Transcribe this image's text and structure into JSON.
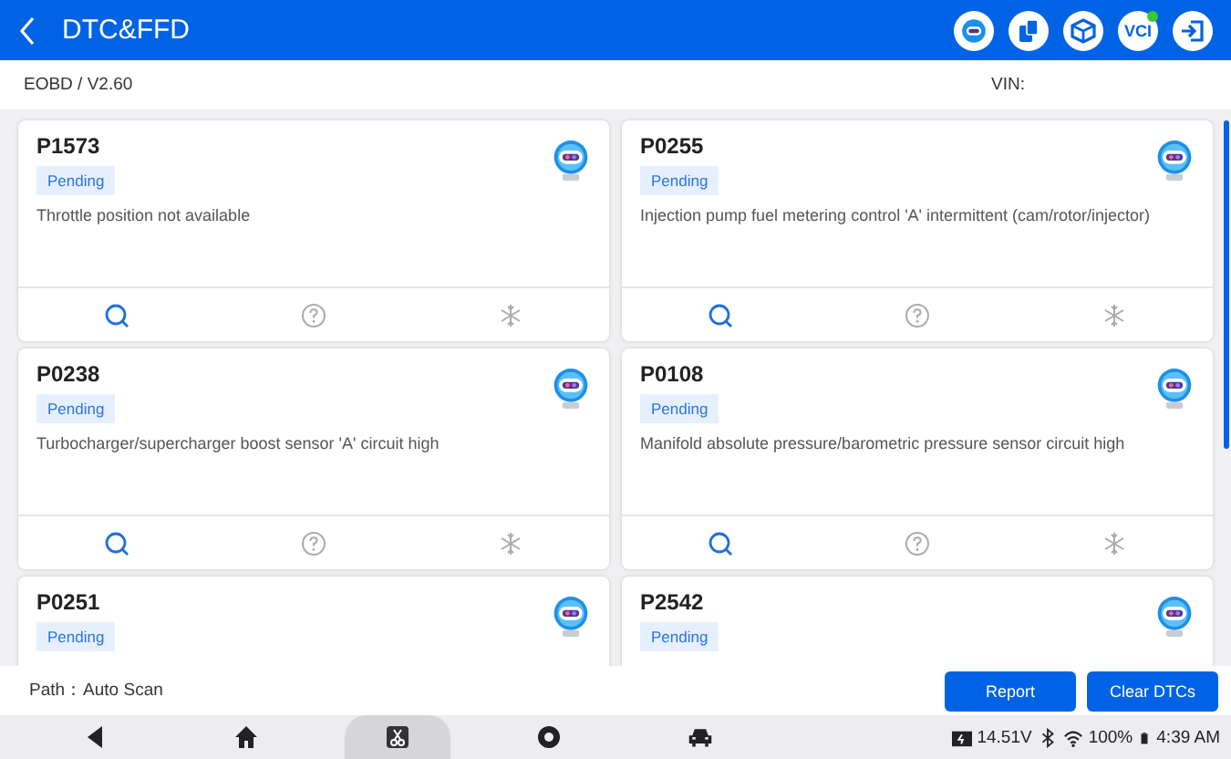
{
  "header": {
    "title": "DTC&FFD",
    "vci_label": "VCI"
  },
  "subheader": {
    "version": "EOBD / V2.60",
    "vin_label": "VIN:"
  },
  "dtcs": [
    {
      "code": "P1573",
      "status": "Pending",
      "description": "Throttle position not available"
    },
    {
      "code": "P0255",
      "status": "Pending",
      "description": "Injection pump fuel metering control 'A' intermittent (cam/rotor/injector)"
    },
    {
      "code": "P0238",
      "status": "Pending",
      "description": "Turbocharger/supercharger boost sensor 'A' circuit high"
    },
    {
      "code": "P0108",
      "status": "Pending",
      "description": "Manifold absolute pressure/barometric pressure sensor circuit high"
    },
    {
      "code": "P0251",
      "status": "Pending"
    },
    {
      "code": "P2542",
      "status": "Pending"
    }
  ],
  "footer": {
    "path_label": "Path：",
    "path": "Auto Scan",
    "buttons": [
      "Report",
      "Clear DTCs"
    ]
  },
  "nav": {
    "items": [
      {
        "kind": "back",
        "selected": false
      },
      {
        "kind": "home",
        "selected": false
      },
      {
        "kind": "diag",
        "selected": true
      },
      {
        "kind": "browser",
        "selected": false
      },
      {
        "kind": "car",
        "selected": false
      }
    ]
  },
  "status": {
    "voltage": "14.51V",
    "battery": "100%",
    "time": "4:39 AM"
  }
}
